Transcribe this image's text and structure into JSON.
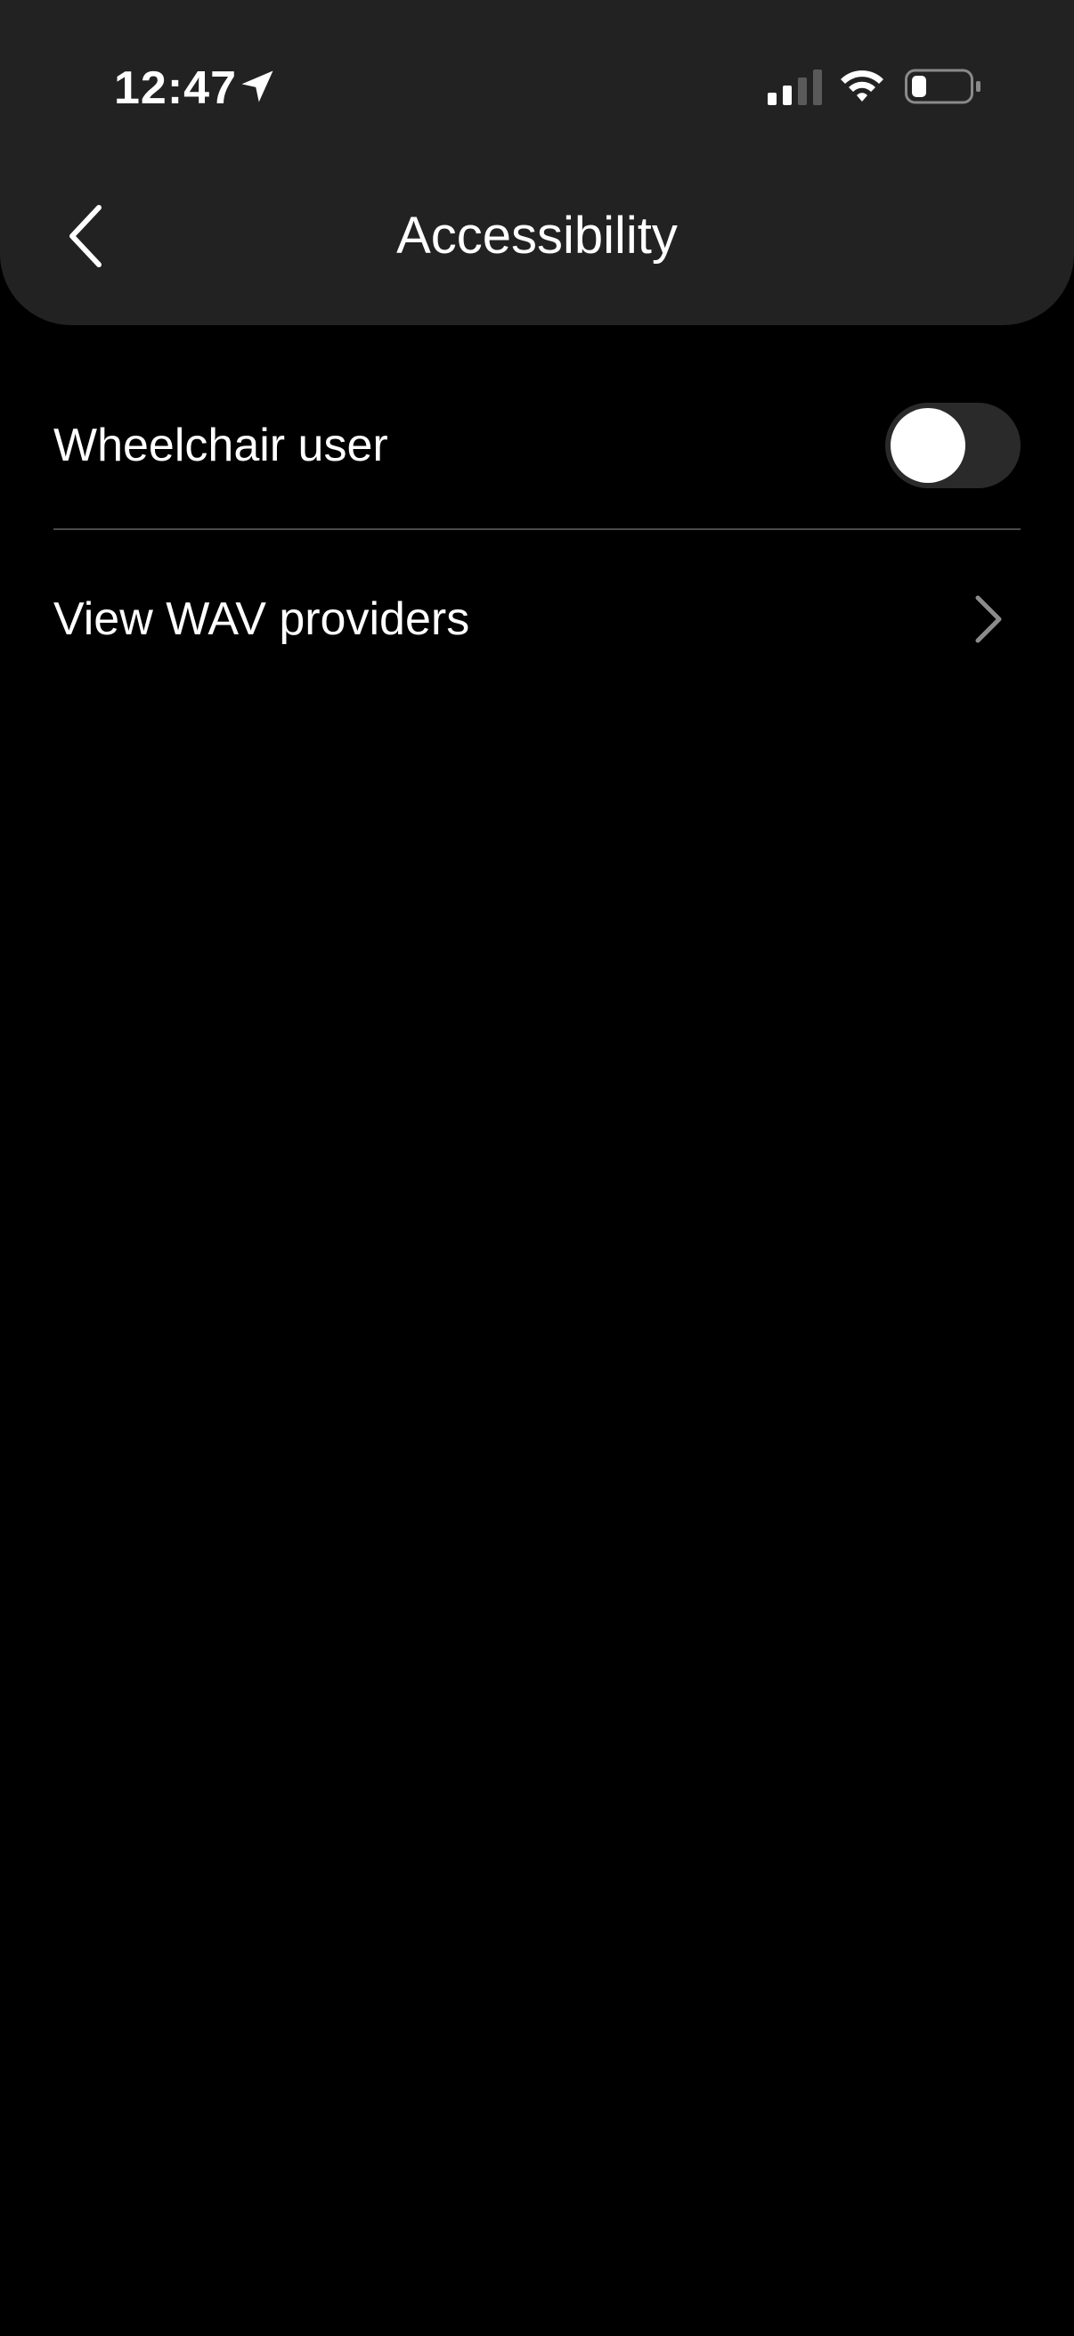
{
  "status_bar": {
    "time": "12:47",
    "icons": [
      "location-arrow-icon",
      "cellular-signal-icon",
      "wifi-icon",
      "battery-icon"
    ]
  },
  "header": {
    "title": "Accessibility",
    "back_icon": "chevron-left-icon"
  },
  "settings": {
    "wheelchair": {
      "label": "Wheelchair user",
      "toggle_on": false
    },
    "wav": {
      "label": "View WAV providers",
      "icon": "chevron-right-icon"
    }
  },
  "colors": {
    "background": "#000000",
    "header": "#232222",
    "toggle_track_off": "#2a2a2a",
    "divider": "#4a4a4a",
    "text": "#ffffff"
  }
}
